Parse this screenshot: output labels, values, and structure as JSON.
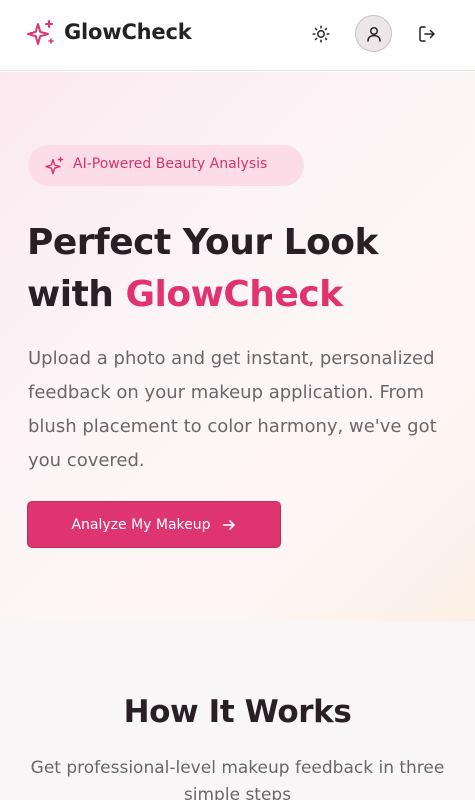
{
  "header": {
    "brand": "GlowCheck",
    "icons": {
      "logo": "sparkles-icon",
      "theme": "sun-icon",
      "profile": "user-icon",
      "logout": "logout-icon"
    }
  },
  "hero": {
    "badge": "AI-Powered Beauty Analysis",
    "title_line1": "Perfect Your Look",
    "title_with": "with ",
    "title_accent": "GlowCheck",
    "description": "Upload a photo and get instant, personalized feedback on your makeup application. From blush placement to color harmony, we've got you covered.",
    "cta_label": "Analyze My Makeup"
  },
  "how_it_works": {
    "title": "How It Works",
    "subtitle": "Get professional-level makeup feedback in three simple steps"
  },
  "colors": {
    "accent": "#de3570",
    "badge_bg": "#fbdce7",
    "text": "#2a1f24",
    "muted": "#6e656a"
  }
}
